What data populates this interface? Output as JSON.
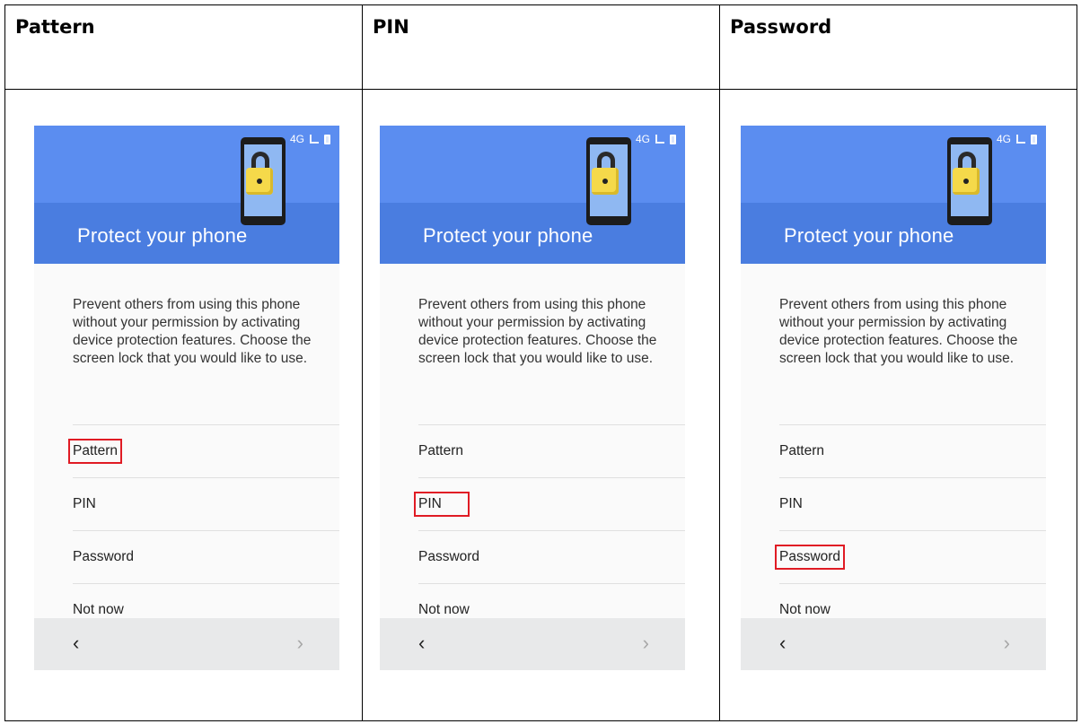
{
  "columns": [
    {
      "heading": "Pattern",
      "selected_index": 0,
      "phone": {
        "status_network": "4G",
        "title": "Protect your phone",
        "description": "Prevent others from using this phone without your permission by activating device protection features. Choose the screen lock that you would like to use.",
        "options": [
          "Pattern",
          "PIN",
          "Password",
          "Not now"
        ],
        "nav_back": "‹",
        "nav_next": "›"
      }
    },
    {
      "heading": "PIN",
      "selected_index": 1,
      "phone": {
        "status_network": "4G",
        "title": "Protect your phone",
        "description": "Prevent others from using this phone without your permission by activating device protection features. Choose the screen lock that you would like to use.",
        "options": [
          "Pattern",
          "PIN",
          "Password",
          "Not now"
        ],
        "nav_back": "‹",
        "nav_next": "›"
      }
    },
    {
      "heading": "Password",
      "selected_index": 2,
      "phone": {
        "status_network": "4G",
        "title": "Protect your phone",
        "description": "Prevent others from using this phone without your permission by activating device protection features. Choose the screen lock that you would like to use.",
        "options": [
          "Pattern",
          "PIN",
          "Password",
          "Not now"
        ],
        "nav_back": "‹",
        "nav_next": "›"
      }
    }
  ],
  "colors": {
    "header_blue": "#4a7de0",
    "header_blue_light": "#5b8df0",
    "highlight_red": "#e01b24",
    "nav_bar": "#e8e9ea"
  },
  "icons": [
    "lock-phone-icon",
    "signal-icon",
    "battery-icon",
    "back-arrow-icon",
    "forward-arrow-icon"
  ]
}
